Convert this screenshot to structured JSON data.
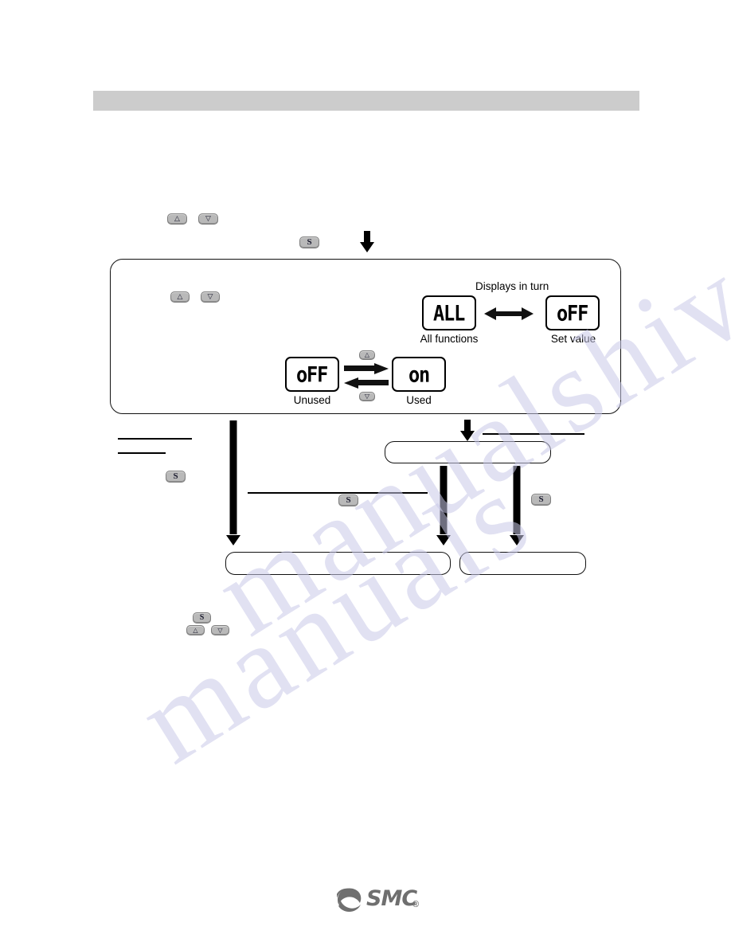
{
  "document": {
    "brand": "SMC",
    "brand_mark": "swirl-logo",
    "registered_mark": "®"
  },
  "header": {
    "title": ""
  },
  "top_controls": {
    "up_button": "△",
    "down_button": "▽",
    "set_button": "S"
  },
  "panel": {
    "note": "Displays in turn",
    "toggle_hint_up": "△",
    "toggle_hint_down": "▽",
    "displays": [
      {
        "value": "ALL",
        "caption": "All functions"
      },
      {
        "value": "oFF",
        "caption": "Set value"
      },
      {
        "value": "oFF",
        "caption": "Unused"
      },
      {
        "value": "on",
        "caption": "Used"
      }
    ],
    "panel_buttons": {
      "up": "△",
      "down": "▽"
    }
  },
  "flow": {
    "boxes": [
      {
        "label": ""
      },
      {
        "label": ""
      },
      {
        "label": ""
      }
    ],
    "set_buttons": [
      {
        "label": "S"
      },
      {
        "label": "S"
      },
      {
        "label": "S"
      }
    ],
    "captions": [
      {
        "text": ""
      },
      {
        "text": ""
      },
      {
        "text": ""
      },
      {
        "text": ""
      },
      {
        "text": ""
      }
    ]
  },
  "bottom_controls": {
    "set_button": "S",
    "up_button": "△",
    "down_button": "▽"
  },
  "watermark": {
    "line1": "manualshive.com",
    "line2": "manuals"
  },
  "colors": {
    "header_band": "#cccccc",
    "button_face": "#b9b9b9",
    "ink": "#000000",
    "logo_gray": "#6f6f6f",
    "watermark": "#c9c9e8"
  }
}
